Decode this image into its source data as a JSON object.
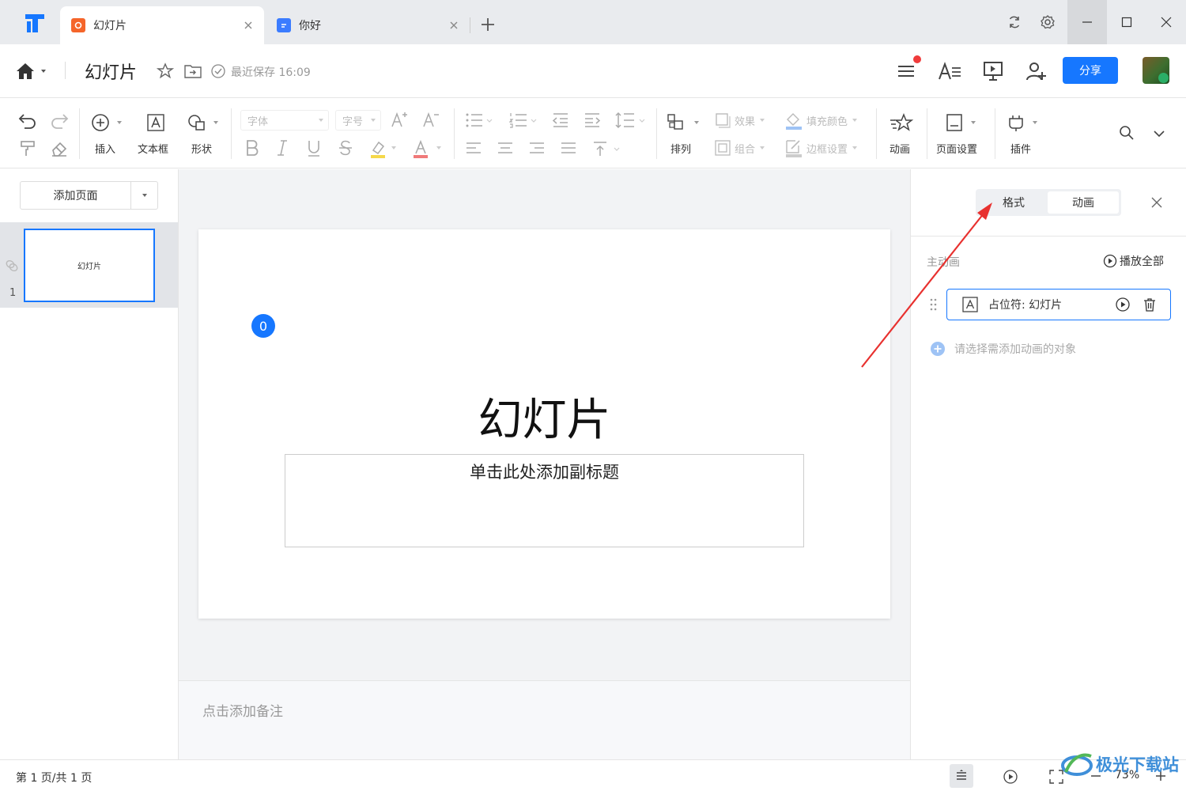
{
  "tabs": [
    {
      "label": "幻灯片",
      "active": true,
      "icon": "slides-app-icon",
      "color": "#f5652a"
    },
    {
      "label": "你好",
      "active": false,
      "icon": "doc-app-icon",
      "color": "#3b7cff"
    }
  ],
  "titlebar": {
    "doc_title": "幻灯片",
    "save_status": "最近保存 16:09",
    "share_label": "分享"
  },
  "toolbar": {
    "insert": "插入",
    "textbox": "文本框",
    "shape": "形状",
    "font_placeholder": "字体",
    "size_placeholder": "字号",
    "effect": "效果",
    "fill_color": "填充颜色",
    "group": "组合",
    "border_settings": "边框设置",
    "arrange": "排列",
    "animation": "动画",
    "page_setup": "页面设置",
    "plugin": "插件"
  },
  "left_pane": {
    "add_page": "添加页面",
    "thumbs": [
      {
        "number": "1",
        "title": "幻灯片"
      }
    ]
  },
  "slide": {
    "badge": "0",
    "title": "幻灯片",
    "subtitle": "单击此处添加副标题"
  },
  "notes_placeholder": "点击添加备注",
  "right_panel": {
    "tabs": [
      "格式",
      "动画"
    ],
    "active_tab": "动画",
    "section_title": "主动画",
    "play_all": "播放全部",
    "item_label": "占位符: 幻灯片",
    "add_hint": "请选择需添加动画的对象"
  },
  "statusbar": {
    "page_info": "第 1 页/共 1 页",
    "zoom": "73%"
  },
  "watermark": "极光下载站",
  "colors": {
    "accent": "#1677ff",
    "annotation_arrow": "#e8312f"
  }
}
